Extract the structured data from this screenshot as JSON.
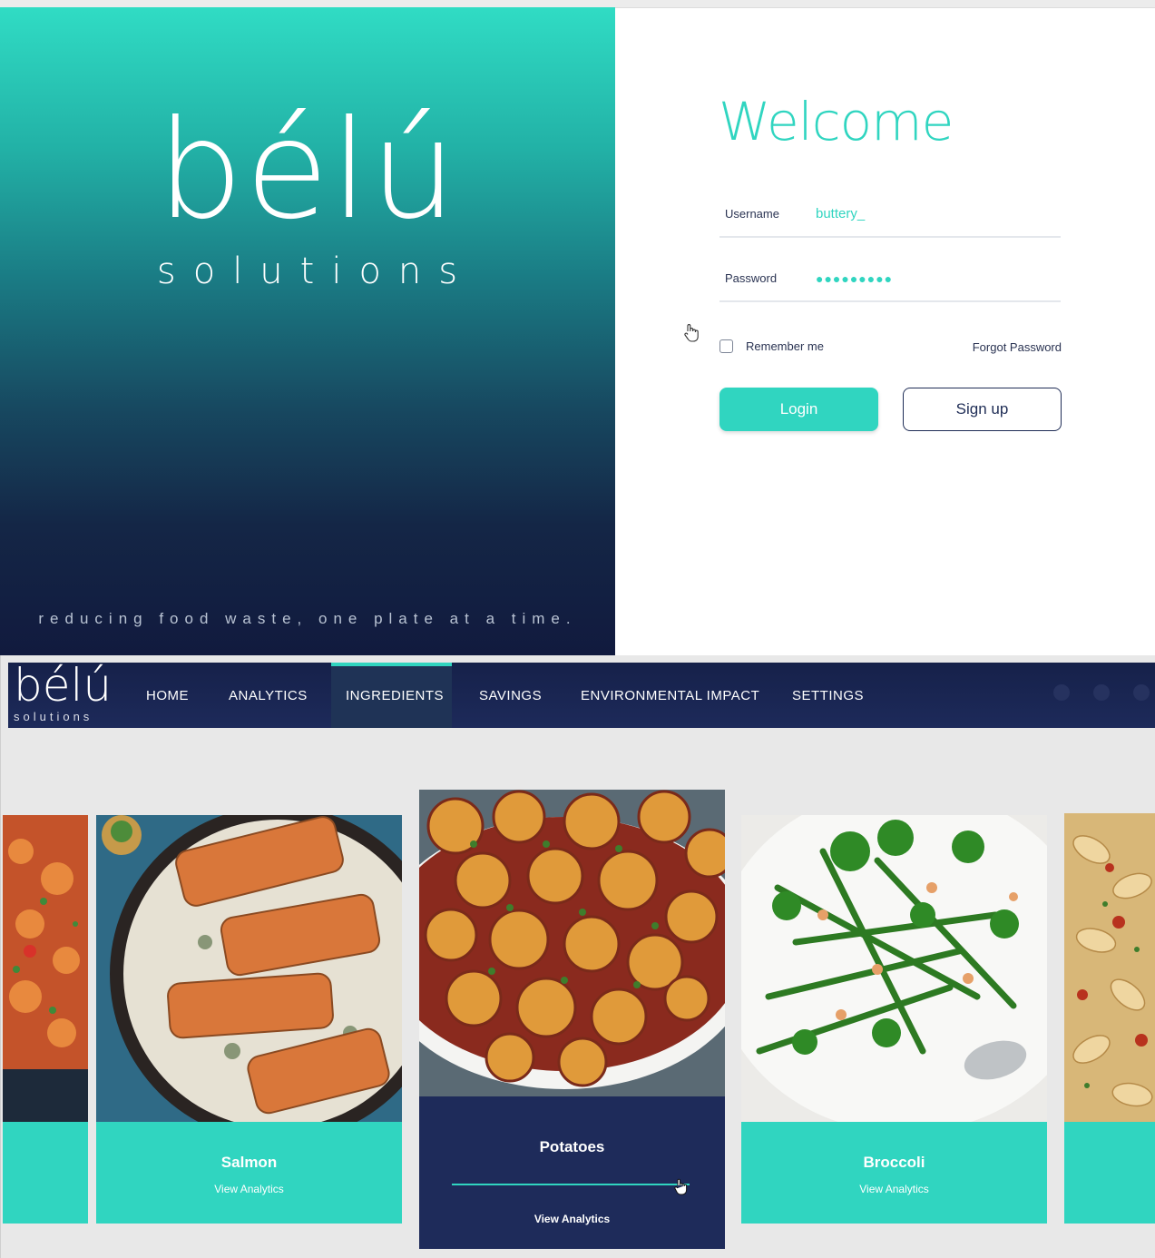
{
  "login": {
    "brand": {
      "logo_word": "bélú",
      "logo_sub": "solutions",
      "tagline": "reducing food waste, one plate at a time."
    },
    "welcome": "Welcome",
    "username": {
      "label": "Username",
      "value": "buttery_"
    },
    "password": {
      "label": "Password",
      "value": "●●●●●●●●●"
    },
    "remember_label": "Remember me",
    "remember_checked": false,
    "forgot_label": "Forgot Password",
    "login_label": "Login",
    "signup_label": "Sign up",
    "colors": {
      "accent": "#30d5c0",
      "navy": "#1f2d56"
    }
  },
  "app": {
    "logo_word": "bélú",
    "logo_sub": "solutions",
    "nav": [
      {
        "label": "HOME"
      },
      {
        "label": "ANALYTICS"
      },
      {
        "label": "INGREDIENTS",
        "active": true
      },
      {
        "label": "SAVINGS"
      },
      {
        "label": "ENVIRONMENTAL IMPACT"
      },
      {
        "label": "SETTINGS"
      }
    ],
    "nav_icons": [
      "user-icon",
      "bell-icon",
      "account-icon"
    ],
    "cards": [
      {
        "title": "",
        "link": ""
      },
      {
        "title": "Salmon",
        "link": "View Analytics"
      },
      {
        "title": "Potatoes",
        "link": "View Analytics",
        "selected": true
      },
      {
        "title": "Broccoli",
        "link": "View Analytics"
      },
      {
        "title": "",
        "link": ""
      }
    ]
  }
}
